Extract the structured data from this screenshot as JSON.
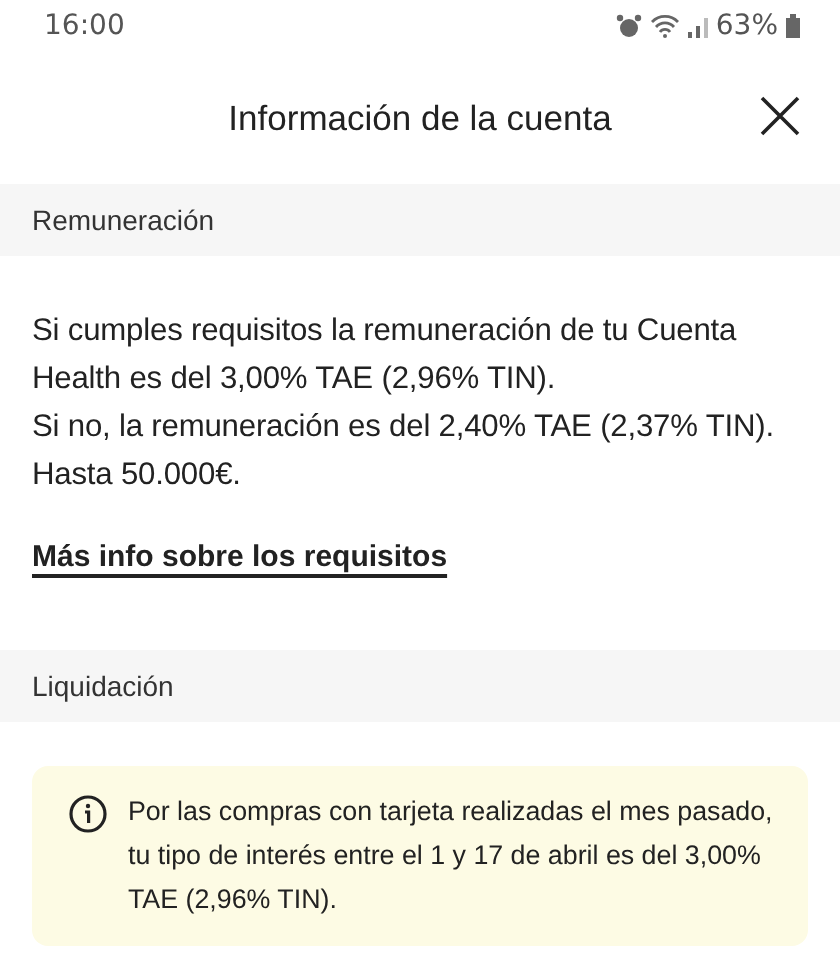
{
  "status_bar": {
    "time": "16:00",
    "battery": "63%"
  },
  "header": {
    "title": "Información de la cuenta"
  },
  "sections": [
    {
      "title": "Remuneración",
      "kind": "text",
      "paragraphs": [
        "Si cumples requisitos la remuneración de tu Cuenta Health es del 3,00% TAE (2,96% TIN).",
        "Si no, la remuneración es del 2,40% TAE (2,37% TIN).",
        "Hasta 50.000€."
      ],
      "link": "Más info sobre los requisitos"
    },
    {
      "title": "Liquidación",
      "kind": "notice",
      "notice": "Por las compras con tarjeta realizadas el mes pasado, tu tipo de interés entre el 1 y 17 de abril es del 3,00% TAE (2,96% TIN)."
    }
  ]
}
